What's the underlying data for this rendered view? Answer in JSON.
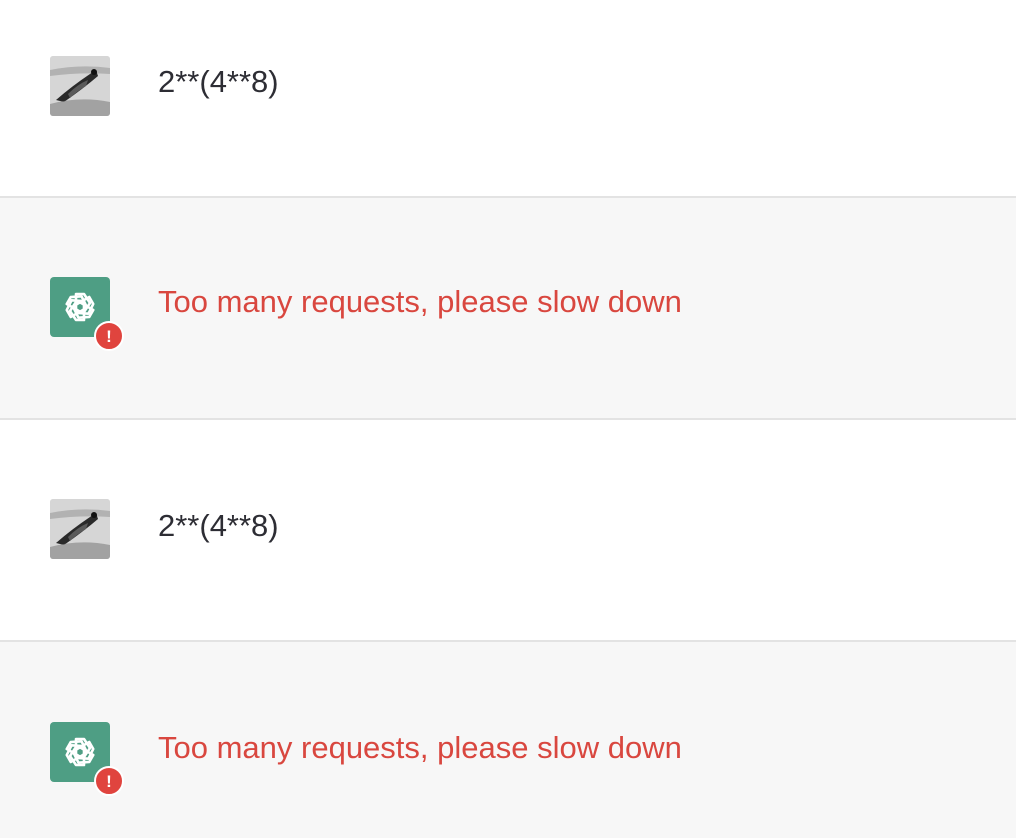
{
  "colors": {
    "assistant_avatar_bg": "#4e9e84",
    "error_text": "#d9473f",
    "error_badge": "#e0443e"
  },
  "icons": {
    "user_avatar": "user-avatar-image",
    "assistant_avatar": "openai-logo-icon",
    "error_badge": "exclamation-icon"
  },
  "messages": [
    {
      "role": "user",
      "text": "2**(4**8)"
    },
    {
      "role": "assistant",
      "text": "Too many requests, please slow down",
      "badge": "!"
    },
    {
      "role": "user",
      "text": "2**(4**8)"
    },
    {
      "role": "assistant",
      "text": "Too many requests, please slow down",
      "badge": "!"
    }
  ]
}
